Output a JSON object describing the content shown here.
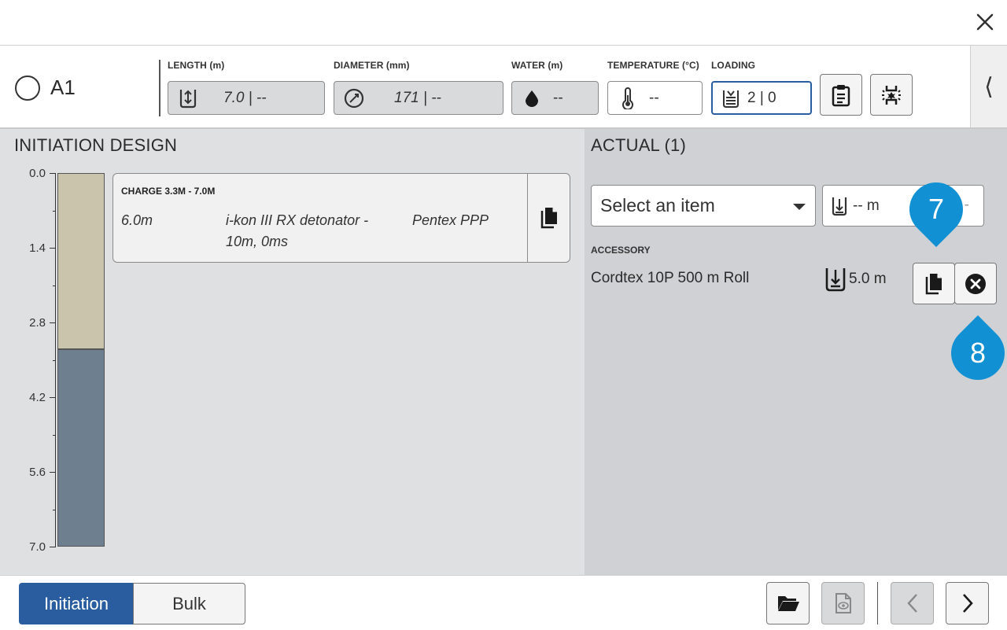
{
  "window": {
    "close_icon": "close-icon"
  },
  "hole": {
    "name": "A1"
  },
  "fields": {
    "length": {
      "label": "LENGTH (m)",
      "value": "7.0 | --",
      "icon": "length-icon"
    },
    "diameter": {
      "label": "DIAMETER (mm)",
      "value": "171 | --",
      "icon": "diameter-icon"
    },
    "water": {
      "label": "WATER (m)",
      "value": "--",
      "icon": "water-drop-icon"
    },
    "temperature": {
      "label": "TEMPERATURE (°C)",
      "value": "--",
      "icon": "thermometer-icon"
    },
    "loading": {
      "label": "LOADING",
      "value": "2 | 0",
      "icon": "loading-icon"
    }
  },
  "header_buttons": {
    "clipboard": "clipboard-icon",
    "explosion": "detonation-icon",
    "side_tab": "⟨"
  },
  "initiation_design": {
    "title": "INITIATION DESIGN",
    "axis_ticks": [
      "0.0",
      "1.4",
      "2.8",
      "4.2",
      "5.6",
      "7.0"
    ],
    "column": {
      "stemming": {
        "from": 0.0,
        "to": 3.3,
        "color": "#cbc4ac"
      },
      "charge": {
        "from": 3.3,
        "to": 7.0,
        "color": "#6e8090"
      }
    },
    "charge_card": {
      "title": "CHARGE 3.3M - 7.0M",
      "depth": "6.0m",
      "detonator": "i-kon III RX detonator - 10m, 0ms",
      "booster": "Pentex PPP"
    }
  },
  "actual": {
    "title": "ACTUAL (1)",
    "select_placeholder": "Select an item",
    "length_value": "-- m",
    "length_suffix": "-",
    "accessory_label": "ACCESSORY",
    "accessory_name": "Cordtex 10P 500 m Roll",
    "accessory_length": "5.0 m"
  },
  "callouts": {
    "seven": "7",
    "eight": "8"
  },
  "footer": {
    "tabs": {
      "initiation": "Initiation",
      "bulk": "Bulk"
    }
  },
  "colors": {
    "accent": "#2a5d9f",
    "callout": "#1191d3"
  }
}
